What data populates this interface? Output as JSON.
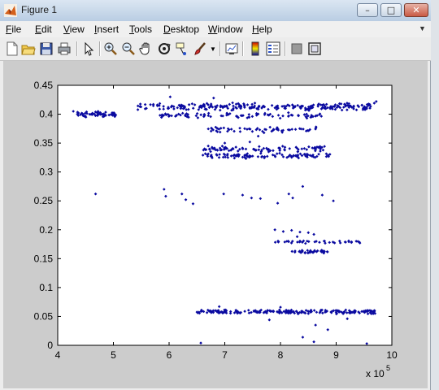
{
  "window": {
    "title": "Figure 1",
    "controls": {
      "minimize": "–",
      "maximize": "□",
      "close": "✕"
    }
  },
  "menu": [
    {
      "pre": "",
      "u": "F",
      "post": "ile"
    },
    {
      "pre": "",
      "u": "E",
      "post": "dit"
    },
    {
      "pre": "",
      "u": "V",
      "post": "iew"
    },
    {
      "pre": "",
      "u": "I",
      "post": "nsert"
    },
    {
      "pre": "",
      "u": "T",
      "post": "ools"
    },
    {
      "pre": "",
      "u": "D",
      "post": "esktop"
    },
    {
      "pre": "",
      "u": "W",
      "post": "indow"
    },
    {
      "pre": "",
      "u": "H",
      "post": "elp"
    }
  ],
  "toolbar": [
    "new-figure-icon",
    "open-file-icon",
    "save-icon",
    "print-icon",
    "select-arrow-icon",
    "zoom-in-icon",
    "zoom-out-icon",
    "pan-hand-icon",
    "rotate-3d-icon",
    "data-cursor-icon",
    "brush-icon",
    "brush-dropdown-icon",
    "link-plot-icon",
    "colorbar-icon",
    "legend-icon",
    "hide-plot-tools-icon",
    "show-plot-tools-icon"
  ],
  "colors": {
    "marker": "#0a0aa0",
    "axes_bg": "#ffffff",
    "figure_bg": "#cccccc"
  },
  "chart_data": {
    "type": "scatter",
    "title": "",
    "xlabel": "",
    "ylabel": "",
    "x_exponent_label": "x 10",
    "x_exponent_power": "5",
    "xlim": [
      4,
      10
    ],
    "ylim": [
      0,
      0.45
    ],
    "xticks": [
      "4",
      "5",
      "6",
      "7",
      "8",
      "9",
      "10"
    ],
    "yticks": [
      "0",
      "0.05",
      "0.1",
      "0.15",
      "0.2",
      "0.25",
      "0.3",
      "0.35",
      "0.4",
      "0.45"
    ],
    "grid": false,
    "marker": "dot",
    "clusters": [
      {
        "x_range": [
          4.35,
          5.05
        ],
        "y": 0.4,
        "y_spread": 0.006,
        "points": 55
      },
      {
        "x_range": [
          5.4,
          9.7
        ],
        "y": 0.413,
        "y_spread": 0.007,
        "points": 230
      },
      {
        "x_range": [
          5.8,
          8.8
        ],
        "y": 0.398,
        "y_spread": 0.005,
        "points": 90
      },
      {
        "x_range": [
          6.7,
          8.7
        ],
        "y": 0.373,
        "y_spread": 0.006,
        "points": 60
      },
      {
        "x_range": [
          6.6,
          8.8
        ],
        "y": 0.34,
        "y_spread": 0.006,
        "points": 85
      },
      {
        "x_range": [
          6.6,
          8.9
        ],
        "y": 0.328,
        "y_spread": 0.005,
        "points": 95
      },
      {
        "x_range": [
          7.9,
          9.5
        ],
        "y": 0.179,
        "y_spread": 0.003,
        "points": 40
      },
      {
        "x_range": [
          8.2,
          8.9
        ],
        "y": 0.162,
        "y_spread": 0.003,
        "points": 35
      },
      {
        "x_range": [
          6.5,
          9.7
        ],
        "y": 0.058,
        "y_spread": 0.004,
        "points": 210
      }
    ],
    "points": [
      [
        4.28,
        0.405
      ],
      [
        4.68,
        0.262
      ],
      [
        5.91,
        0.27
      ],
      [
        5.94,
        0.258
      ],
      [
        6.23,
        0.262
      ],
      [
        6.3,
        0.252
      ],
      [
        6.43,
        0.245
      ],
      [
        6.98,
        0.262
      ],
      [
        7.32,
        0.26
      ],
      [
        7.48,
        0.255
      ],
      [
        7.64,
        0.254
      ],
      [
        7.95,
        0.246
      ],
      [
        8.15,
        0.262
      ],
      [
        8.22,
        0.255
      ],
      [
        8.4,
        0.275
      ],
      [
        8.75,
        0.26
      ],
      [
        8.95,
        0.25
      ],
      [
        7.2,
        0.343
      ],
      [
        7.45,
        0.352
      ],
      [
        8.4,
        0.014
      ],
      [
        8.6,
        0.006
      ],
      [
        9.55,
        0.003
      ],
      [
        6.57,
        0.004
      ],
      [
        7.0,
        0.35
      ],
      [
        7.6,
        0.362
      ],
      [
        6.02,
        0.43
      ],
      [
        6.8,
        0.428
      ],
      [
        9.72,
        0.422
      ],
      [
        7.9,
        0.2
      ],
      [
        8.05,
        0.197
      ],
      [
        8.2,
        0.199
      ],
      [
        8.35,
        0.196
      ],
      [
        8.5,
        0.195
      ],
      [
        8.6,
        0.192
      ],
      [
        8.3,
        0.188
      ],
      [
        8.63,
        0.035
      ],
      [
        8.85,
        0.027
      ],
      [
        7.8,
        0.044
      ],
      [
        9.2,
        0.046
      ],
      [
        8.0,
        0.066
      ],
      [
        6.9,
        0.067
      ]
    ]
  }
}
